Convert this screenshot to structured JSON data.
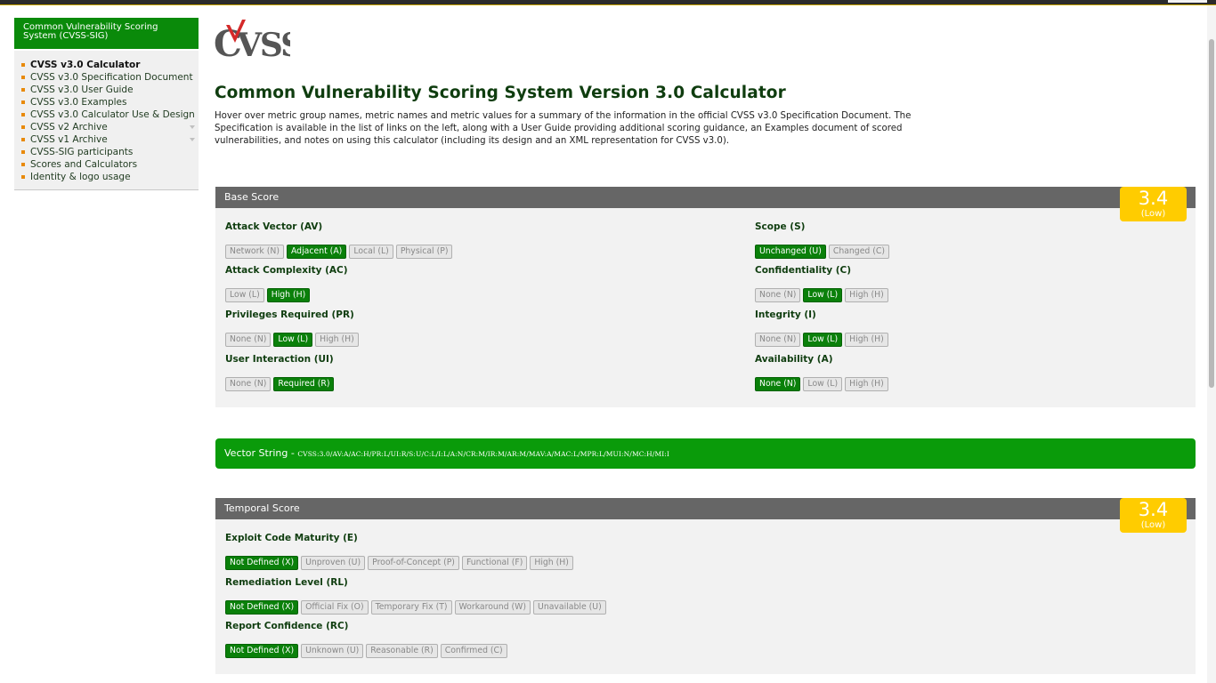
{
  "sidebar": {
    "header": "Common Vulnerability Scoring System (CVSS-SIG)",
    "items": [
      {
        "label": "CVSS v3.0 Calculator"
      },
      {
        "label": "CVSS v3.0 Specification Document"
      },
      {
        "label": "CVSS v3.0 User Guide"
      },
      {
        "label": "CVSS v3.0 Examples"
      },
      {
        "label": "CVSS v3.0 Calculator Use & Design"
      },
      {
        "label": "CVSS v2 Archive"
      },
      {
        "label": "CVSS v1 Archive"
      },
      {
        "label": "CVSS-SIG participants"
      },
      {
        "label": "Scores and Calculators"
      },
      {
        "label": "Identity & logo usage"
      }
    ]
  },
  "logo": {
    "text_c": "C",
    "text_vss": "VSS"
  },
  "page": {
    "title": "Common Vulnerability Scoring System Version 3.0 Calculator",
    "intro": "Hover over metric group names, metric names and metric values for a summary of the information in the official CVSS v3.0 Specification Document. The Specification is available in the list of links on the left, along with a User Guide providing additional scoring guidance, an Examples document of scored vulnerabilities, and notes on using this calculator (including its design and an XML representation for CVSS v3.0)."
  },
  "base": {
    "title": "Base Score",
    "score": "3.4",
    "severity": "(Low)",
    "av": {
      "name": "Attack Vector (AV)",
      "options": [
        "Network (N)",
        "Adjacent (A)",
        "Local (L)",
        "Physical (P)"
      ],
      "selected": "Adjacent (A)"
    },
    "ac": {
      "name": "Attack Complexity (AC)",
      "options": [
        "Low (L)",
        "High (H)"
      ],
      "selected": "High (H)"
    },
    "pr": {
      "name": "Privileges Required (PR)",
      "options": [
        "None (N)",
        "Low (L)",
        "High (H)"
      ],
      "selected": "Low (L)"
    },
    "ui": {
      "name": "User Interaction (UI)",
      "options": [
        "None (N)",
        "Required (R)"
      ],
      "selected": "Required (R)"
    },
    "s": {
      "name": "Scope (S)",
      "options": [
        "Unchanged (U)",
        "Changed (C)"
      ],
      "selected": "Unchanged (U)"
    },
    "c": {
      "name": "Confidentiality (C)",
      "options": [
        "None (N)",
        "Low (L)",
        "High (H)"
      ],
      "selected": "Low (L)"
    },
    "i": {
      "name": "Integrity (I)",
      "options": [
        "None (N)",
        "Low (L)",
        "High (H)"
      ],
      "selected": "Low (L)"
    },
    "a": {
      "name": "Availability (A)",
      "options": [
        "None (N)",
        "Low (L)",
        "High (H)"
      ],
      "selected": "None (N)"
    }
  },
  "vector": {
    "label": "Vector String - ",
    "value": "CVSS:3.0/AV:A/AC:H/PR:L/UI:R/S:U/C:L/I:L/A:N/CR:M/IR:M/AR:M/MAV:A/MAC:L/MPR:L/MUI:N/MC:H/MI:I"
  },
  "temporal": {
    "title": "Temporal Score",
    "score": "3.4",
    "severity": "(Low)",
    "e": {
      "name": "Exploit Code Maturity (E)",
      "options": [
        "Not Defined (X)",
        "Unproven (U)",
        "Proof-of-Concept (P)",
        "Functional (F)",
        "High (H)"
      ],
      "selected": "Not Defined (X)"
    },
    "rl": {
      "name": "Remediation Level (RL)",
      "options": [
        "Not Defined (X)",
        "Official Fix (O)",
        "Temporary Fix (T)",
        "Workaround (W)",
        "Unavailable (U)"
      ],
      "selected": "Not Defined (X)"
    },
    "rc": {
      "name": "Report Confidence (RC)",
      "options": [
        "Not Defined (X)",
        "Unknown (U)",
        "Reasonable (R)",
        "Confirmed (C)"
      ],
      "selected": "Not Defined (X)"
    }
  },
  "colors": {
    "brand_green": "#0a8a0a",
    "selected_green": "#0a800a",
    "score_yellow": "#ffcc00",
    "logo_red": "#d42a2a"
  }
}
